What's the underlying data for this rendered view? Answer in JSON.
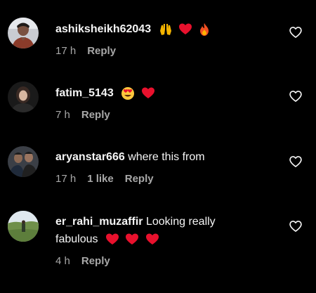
{
  "comments": [
    {
      "username": "ashiksheikh62043",
      "text": "",
      "time": "17 h",
      "likes": "",
      "reply_label": "Reply",
      "emojis": [
        "raising-hands",
        "red-heart",
        "fire"
      ]
    },
    {
      "username": "fatim_5143",
      "text": "",
      "time": "7 h",
      "likes": "",
      "reply_label": "Reply",
      "emojis": [
        "heart-eyes",
        "red-heart"
      ]
    },
    {
      "username": "aryanstar666",
      "text": "where this from",
      "time": "17 h",
      "likes": "1 like",
      "reply_label": "Reply",
      "emojis": []
    },
    {
      "username": "er_rahi_muzaffir",
      "text": "Looking really",
      "text_line2": "fabulous",
      "time": "4 h",
      "likes": "",
      "reply_label": "Reply",
      "emojis": [
        "red-heart",
        "red-heart",
        "red-heart"
      ]
    }
  ],
  "colors": {
    "background": "#000000",
    "text": "#f5f5f5",
    "secondary": "#a8a8a8",
    "heart": "#e8112d"
  },
  "icons": {
    "like": "heart-outline-icon"
  }
}
